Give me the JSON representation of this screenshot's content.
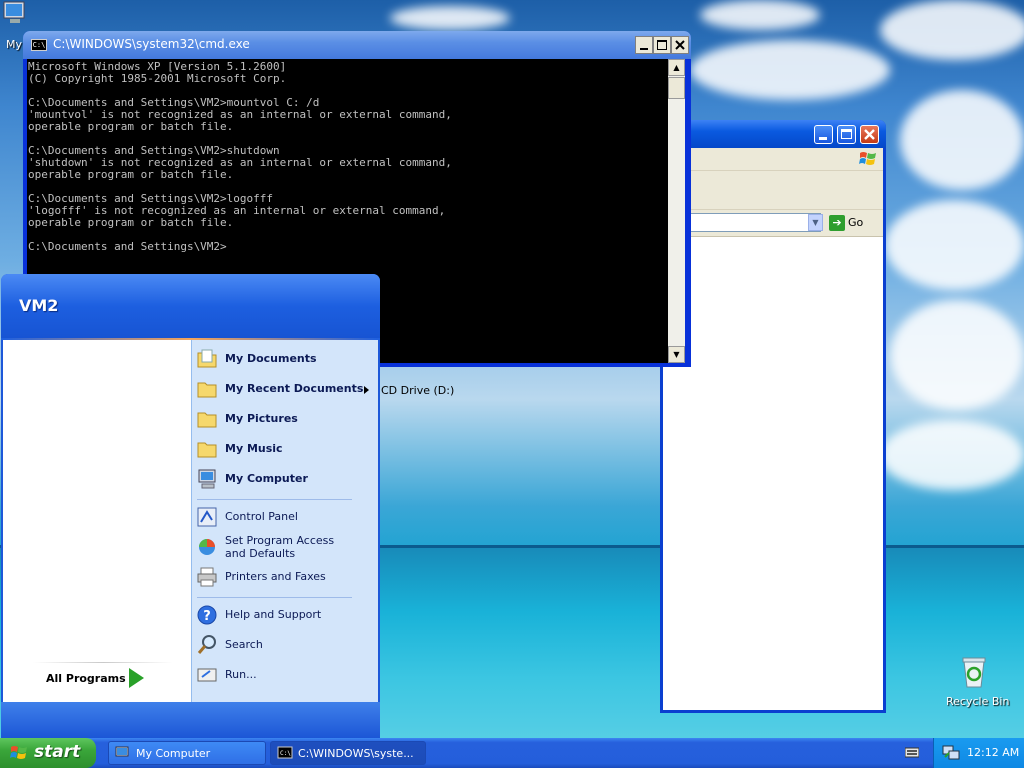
{
  "desktop": {
    "icons": [
      {
        "label": "My",
        "name": "my-computer-desktop-icon"
      },
      {
        "label": "Recycle Bin",
        "name": "recycle-bin-icon"
      }
    ]
  },
  "explorer": {
    "go_label": "Go",
    "drive_label": "CD Drive (D:)"
  },
  "cmd": {
    "title": "C:\\WINDOWS\\system32\\cmd.exe",
    "icon_text": "C:\\",
    "console_lines": [
      "Microsoft Windows XP [Version 5.1.2600]",
      "(C) Copyright 1985-2001 Microsoft Corp.",
      "",
      "C:\\Documents and Settings\\VM2>mountvol C: /d",
      "'mountvol' is not recognized as an internal or external command,",
      "operable program or batch file.",
      "",
      "C:\\Documents and Settings\\VM2>shutdown",
      "'shutdown' is not recognized as an internal or external command,",
      "operable program or batch file.",
      "",
      "C:\\Documents and Settings\\VM2>logofff",
      "'logofff' is not recognized as an internal or external command,",
      "operable program or batch file.",
      "",
      "C:\\Documents and Settings\\VM2>"
    ]
  },
  "start_menu": {
    "user": "VM2",
    "all_programs": "All Programs",
    "places": [
      {
        "label": "My Documents",
        "icon": "my-documents-icon"
      },
      {
        "label": "My Recent Documents",
        "icon": "recent-documents-icon"
      },
      {
        "label": "My Pictures",
        "icon": "my-pictures-icon"
      },
      {
        "label": "My Music",
        "icon": "my-music-icon"
      },
      {
        "label": "My Computer",
        "icon": "my-computer-icon"
      }
    ],
    "system": [
      {
        "label": "Control Panel",
        "icon": "control-panel-icon"
      },
      {
        "label": "Set Program Access and Defaults",
        "icon": "program-access-icon"
      },
      {
        "label": "Printers and Faxes",
        "icon": "printer-icon"
      }
    ],
    "help": [
      {
        "label": "Help and Support",
        "icon": "help-icon"
      },
      {
        "label": "Search",
        "icon": "search-icon"
      },
      {
        "label": "Run...",
        "icon": "run-icon"
      }
    ]
  },
  "taskbar": {
    "start_label": "start",
    "buttons": [
      {
        "label": "My Computer",
        "icon": "my-computer-icon"
      },
      {
        "label": "C:\\WINDOWS\\syste...",
        "icon": "cmd-icon"
      }
    ],
    "clock": "12:12 AM"
  }
}
